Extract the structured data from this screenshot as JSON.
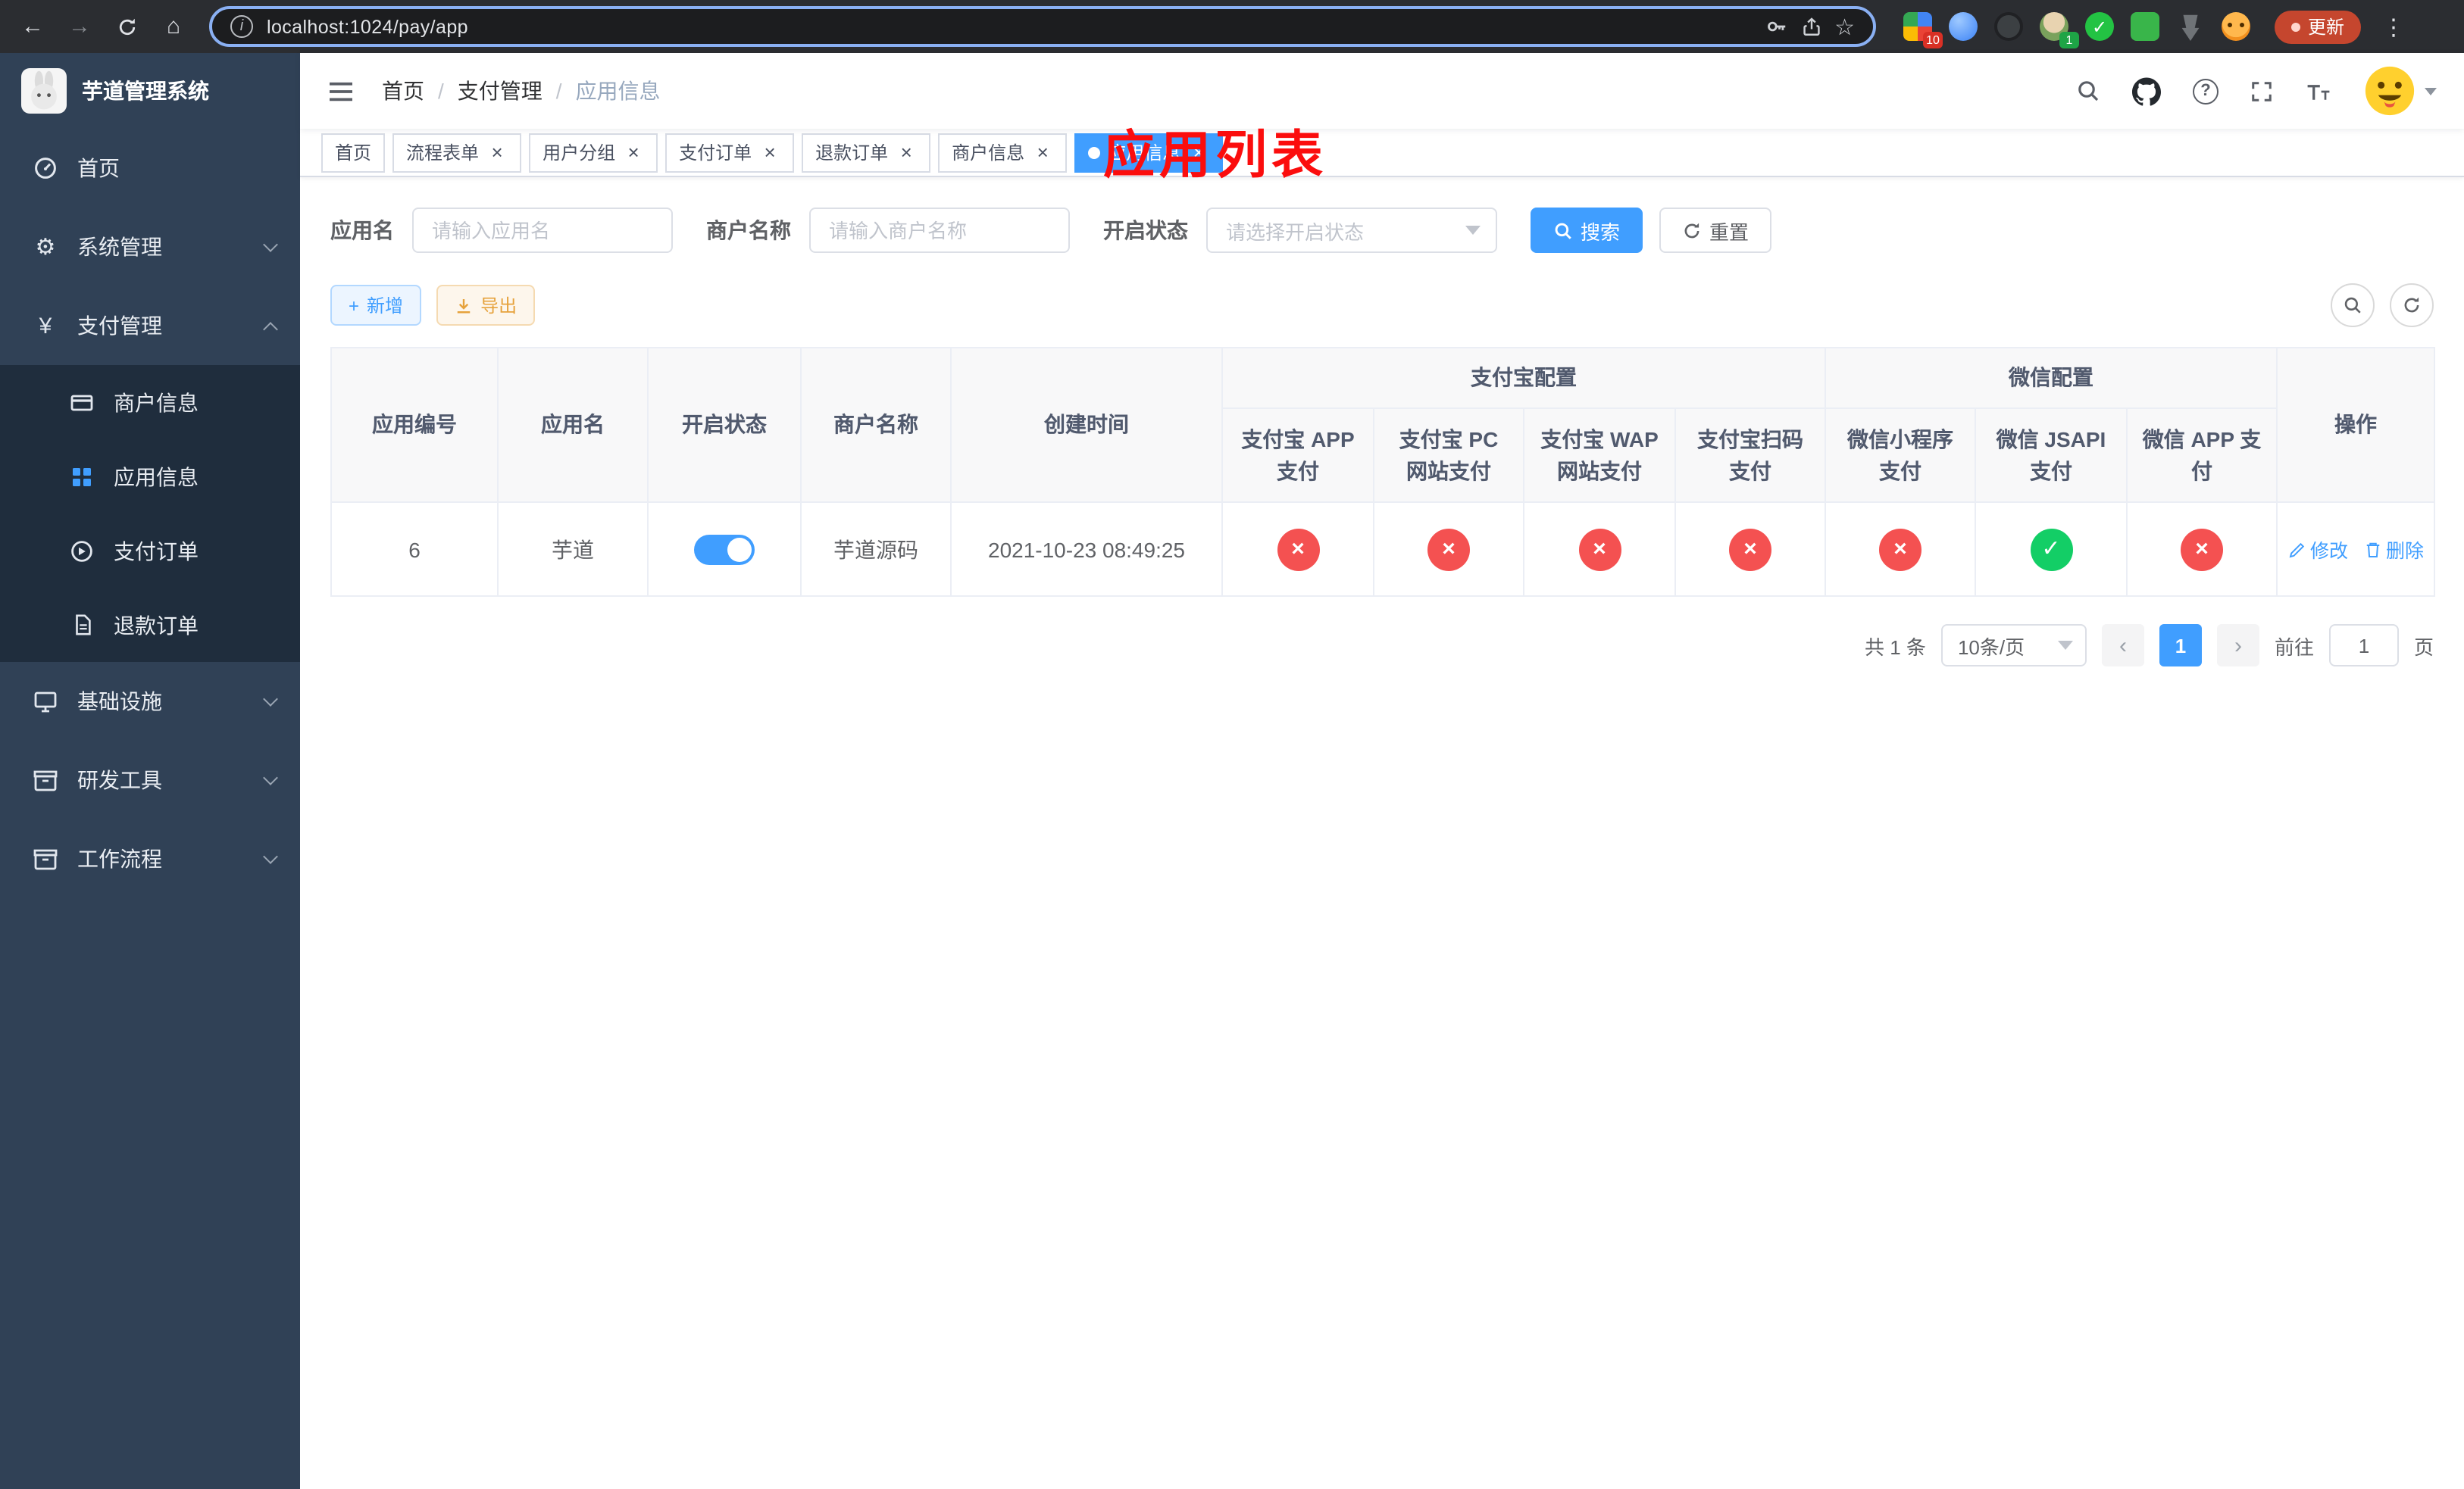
{
  "browser": {
    "url": "localhost:1024/pay/app",
    "update_button_label": "更新",
    "ext_badge_grid": "10",
    "ext_badge_profile": "1"
  },
  "app": {
    "title": "芋道管理系统",
    "annotation": "应用列表"
  },
  "sidebar": {
    "items": [
      {
        "label": "首页"
      },
      {
        "label": "系统管理"
      },
      {
        "label": "支付管理"
      },
      {
        "label": "基础设施"
      },
      {
        "label": "研发工具"
      },
      {
        "label": "工作流程"
      }
    ],
    "payment_children": [
      {
        "label": "商户信息"
      },
      {
        "label": "应用信息"
      },
      {
        "label": "支付订单"
      },
      {
        "label": "退款订单"
      }
    ]
  },
  "header": {
    "breadcrumb": [
      "首页",
      "支付管理",
      "应用信息"
    ],
    "separator": "/"
  },
  "tabs": [
    {
      "label": "首页",
      "closable": false,
      "active": false
    },
    {
      "label": "流程表单",
      "closable": true,
      "active": false
    },
    {
      "label": "用户分组",
      "closable": true,
      "active": false
    },
    {
      "label": "支付订单",
      "closable": true,
      "active": false
    },
    {
      "label": "退款订单",
      "closable": true,
      "active": false
    },
    {
      "label": "商户信息",
      "closable": true,
      "active": false
    },
    {
      "label": "应用信息",
      "closable": true,
      "active": true
    }
  ],
  "filters": {
    "app_name_label": "应用名",
    "app_name_placeholder": "请输入应用名",
    "merchant_label": "商户名称",
    "merchant_placeholder": "请输入商户名称",
    "status_label": "开启状态",
    "status_placeholder": "请选择开启状态",
    "search_button": "搜索",
    "reset_button": "重置"
  },
  "toolbar": {
    "add_button": "新增",
    "export_button": "导出"
  },
  "table": {
    "headers": [
      "应用编号",
      "应用名",
      "开启状态",
      "商户名称",
      "创建时间"
    ],
    "groups": [
      {
        "label": "支付宝配置",
        "children": [
          "支付宝 APP 支付",
          "支付宝 PC 网站支付",
          "支付宝 WAP 网站支付",
          "支付宝扫码支付"
        ]
      },
      {
        "label": "微信配置",
        "children": [
          "微信小程序支付",
          "微信 JSAPI 支付",
          "微信 APP 支付"
        ]
      }
    ],
    "action_header": "操作",
    "row": {
      "id": "6",
      "name": "芋道",
      "status_on": true,
      "merchant": "芋道源码",
      "created": "2021-10-23 08:49:25",
      "configs": [
        false,
        false,
        false,
        false,
        false,
        true,
        false
      ],
      "edit_label": "修改",
      "delete_label": "删除"
    }
  },
  "pagination": {
    "total_text": "共 1 条",
    "page_size": "10条/页",
    "current_page": "1",
    "goto_label": "前往",
    "goto_value": "1",
    "page_suffix": "页"
  },
  "icons": {
    "cross": "×",
    "check": "✓",
    "close": "×",
    "prev": "‹",
    "next": "›",
    "question": "?",
    "info": "i",
    "star": "☆",
    "gear": "⚙",
    "yen": "¥",
    "plus": "+",
    "back": "←",
    "forward": "→",
    "home": "⌂",
    "menu_dots": "⋮"
  },
  "colors": {
    "primary": "#409eff",
    "success": "#13ce66",
    "danger": "#f45151",
    "warning": "#e6a23c",
    "sidebar_bg": "#304156",
    "submenu_bg": "#1f2d3d"
  }
}
